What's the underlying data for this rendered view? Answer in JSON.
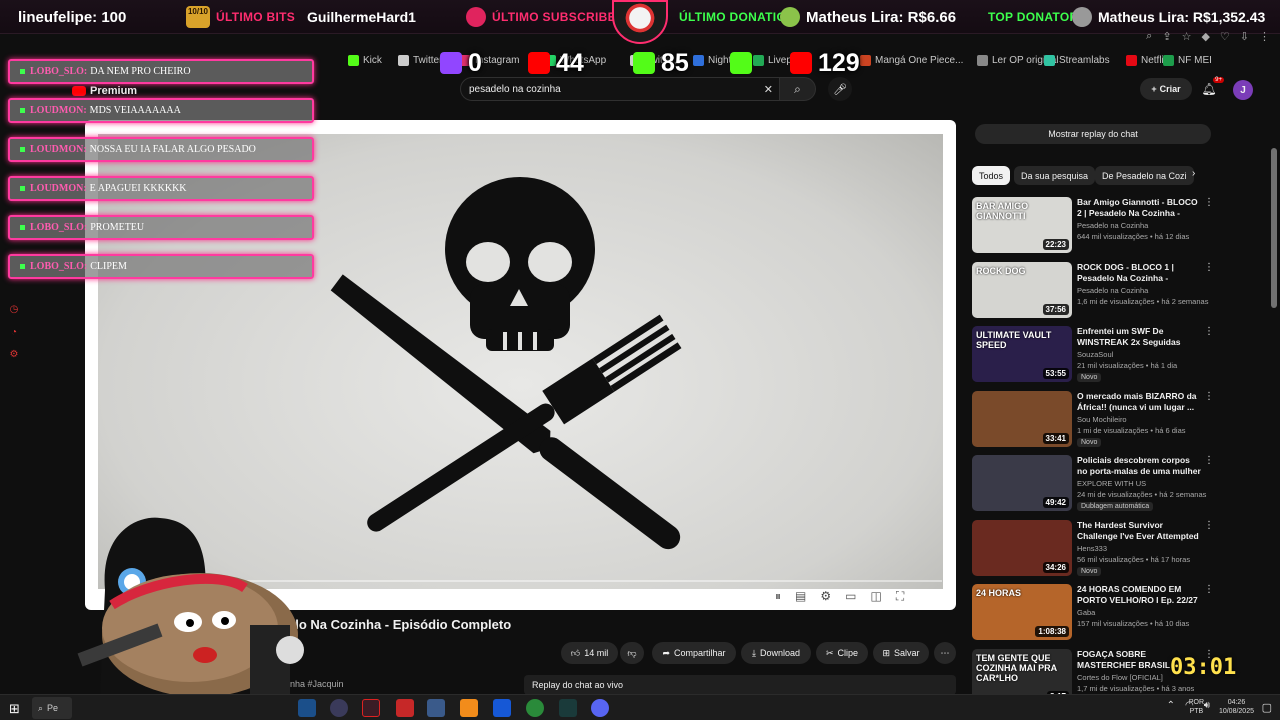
{
  "overlay": {
    "line_user": "lineufelipe: 100",
    "bits_badge": "10/10",
    "bits_label": "ÚLTIMO BITS",
    "bits_user": "GuilhermeHard1",
    "subscriber_label": "ÚLTIMO SUBSCRIBER",
    "donation_label": "ÚLTIMO DONATION",
    "donation_value": "Matheus Lira: R$6.66",
    "top_donator_label": "TOP DONATOR",
    "top_donator_value": "Matheus Lira: R$1,352.43",
    "timer": "03:01",
    "colors": {
      "accent": "#ff2d6f",
      "green": "#3dff4d",
      "chat_border": "#ff3aa0"
    }
  },
  "stats": [
    {
      "platform": "twitch",
      "value": "0",
      "color": "#9146ff"
    },
    {
      "platform": "youtube",
      "value": "44",
      "color": "#ff0000"
    },
    {
      "platform": "kick",
      "value": "85",
      "color": "#53fc18"
    },
    {
      "platform": "kick",
      "value": "",
      "color": "#53fc18"
    },
    {
      "platform": "youtube",
      "value": "129",
      "color": "#ff0000"
    }
  ],
  "bookmarks": [
    {
      "label": "Kick",
      "color": "#53fc18"
    },
    {
      "label": "Twitter",
      "color": "#cccccc"
    },
    {
      "label": "Instagram",
      "color": "#e1306c"
    },
    {
      "label": "WhatsApp",
      "color": "#25d366"
    },
    {
      "label": "Twitter,...",
      "color": "#cccccc"
    },
    {
      "label": "Nightbot",
      "color": "#2f6fdb"
    },
    {
      "label": "Livepix",
      "color": "#22aa55"
    },
    {
      "label": "Mangá One Piece...",
      "color": "#cc4422"
    },
    {
      "label": "Ler OP original",
      "color": "#888888"
    },
    {
      "label": "Streamlabs",
      "color": "#31c3a2"
    },
    {
      "label": "Netflix",
      "color": "#e50914"
    },
    {
      "label": "NF MEI",
      "color": "#1d9d4b"
    }
  ],
  "youtube": {
    "logo": "Premium",
    "search_value": "pesadelo na cozinha",
    "create_label": "Criar",
    "bell_count": "9+",
    "avatar": "J",
    "video_title": "elo Na Cozinha - Episódio Completo",
    "desc_tag": "rinha #Jacquin",
    "replay_box": "Replay do chat ao vivo",
    "actions": {
      "like": "14 mil",
      "share": "Compartilhar",
      "download": "Download",
      "clip": "Clipe",
      "save": "Salvar"
    },
    "show_replay": "Mostrar replay do chat",
    "chips": [
      "Todos",
      "Da sua pesquisa",
      "De Pesadelo na Cozi"
    ]
  },
  "chat": [
    {
      "user": "LOBO_SLO:",
      "text": "DA NEM PRO CHEIRO"
    },
    {
      "user": "LOUDMON:",
      "text": "MDS VEIAAAAAAA"
    },
    {
      "user": "LOUDMON:",
      "text": "NOSSA EU IA FALAR ALGO PESADO"
    },
    {
      "user": "LOUDMON:",
      "text": "E APAGUEI KKKKKK"
    },
    {
      "user": "LOBO_SLO:",
      "text": "PROMETEU"
    },
    {
      "user": "LOBO_SLO:",
      "text": "CLIPEM"
    }
  ],
  "recommendations": [
    {
      "title": "Bar Amigo Giannotti - BLOCO 2 | Pesadelo Na Cozinha - Episód...",
      "channel": "Pesadelo na Cozinha",
      "meta": "644 mil visualizações • há 12 dias",
      "duration": "22:23",
      "thumb_text": "BAR AMIGO GIANNOTTI",
      "badge": "",
      "thumb_color": "#d8d8d4"
    },
    {
      "title": "ROCK DOG - BLOCO 1 | Pesadelo Na Cozinha - Episód...",
      "channel": "Pesadelo na Cozinha",
      "meta": "1,6 mi de visualizações • há 2 semanas",
      "duration": "37:56",
      "thumb_text": "ROCK DOG",
      "badge": "",
      "thumb_color": "#d5d5d1"
    },
    {
      "title": "Enfrentei um SWF De WINSTREAK 2x Seguidas Com...",
      "channel": "SouzaSoul",
      "meta": "21 mil visualizações • há 1 dia",
      "duration": "53:55",
      "thumb_text": "ULTIMATE VAULT SPEED",
      "badge": "Novo",
      "thumb_color": "#2a1f4a"
    },
    {
      "title": "O mercado mais BIZARRO da África!! (nunca vi um lugar ...",
      "channel": "Sou Mochileiro",
      "meta": "1 mi de visualizações • há 6 dias",
      "duration": "33:41",
      "thumb_text": "",
      "badge": "Novo",
      "thumb_color": "#7a4a2a"
    },
    {
      "title": "Policiais descobrem corpos no porta-malas de uma mulher ...",
      "channel": "EXPLORE WITH US",
      "meta": "24 mi de visualizações • há 2 semanas",
      "duration": "49:42",
      "thumb_text": "",
      "badge": "Dublagem automática",
      "thumb_color": "#3a3a48"
    },
    {
      "title": "The Hardest Survivor Challenge I've Ever Attempted",
      "channel": "Hens333",
      "meta": "56 mil visualizações • há 17 horas",
      "duration": "34:26",
      "thumb_text": "",
      "badge": "Novo",
      "thumb_color": "#6a2a20"
    },
    {
      "title": "24 HORAS COMENDO EM PORTO VELHO/RO I Ep. 22/27",
      "channel": "Gaba",
      "meta": "157 mil visualizações • há 10 dias",
      "duration": "1:08:38",
      "thumb_text": "24 HORAS",
      "badge": "",
      "thumb_color": "#b5652a"
    },
    {
      "title": "FOGAÇA SOBRE MASTERCHEF BRASIL | Cortes do Flow",
      "channel": "Cortes do Flow [OFICIAL]",
      "meta": "1,7 mi de visualizações • há 3 anos",
      "duration": "8:17",
      "thumb_text": "TEM GENTE QUE COZINHA MAI PRA CAR*LHO",
      "badge": "",
      "thumb_color": "#2a2a2a"
    }
  ],
  "taskbar": {
    "search": "Pe",
    "lang_line1": "POR",
    "lang_line2": "PTB",
    "time": "04:26",
    "date": "10/08/2025"
  }
}
